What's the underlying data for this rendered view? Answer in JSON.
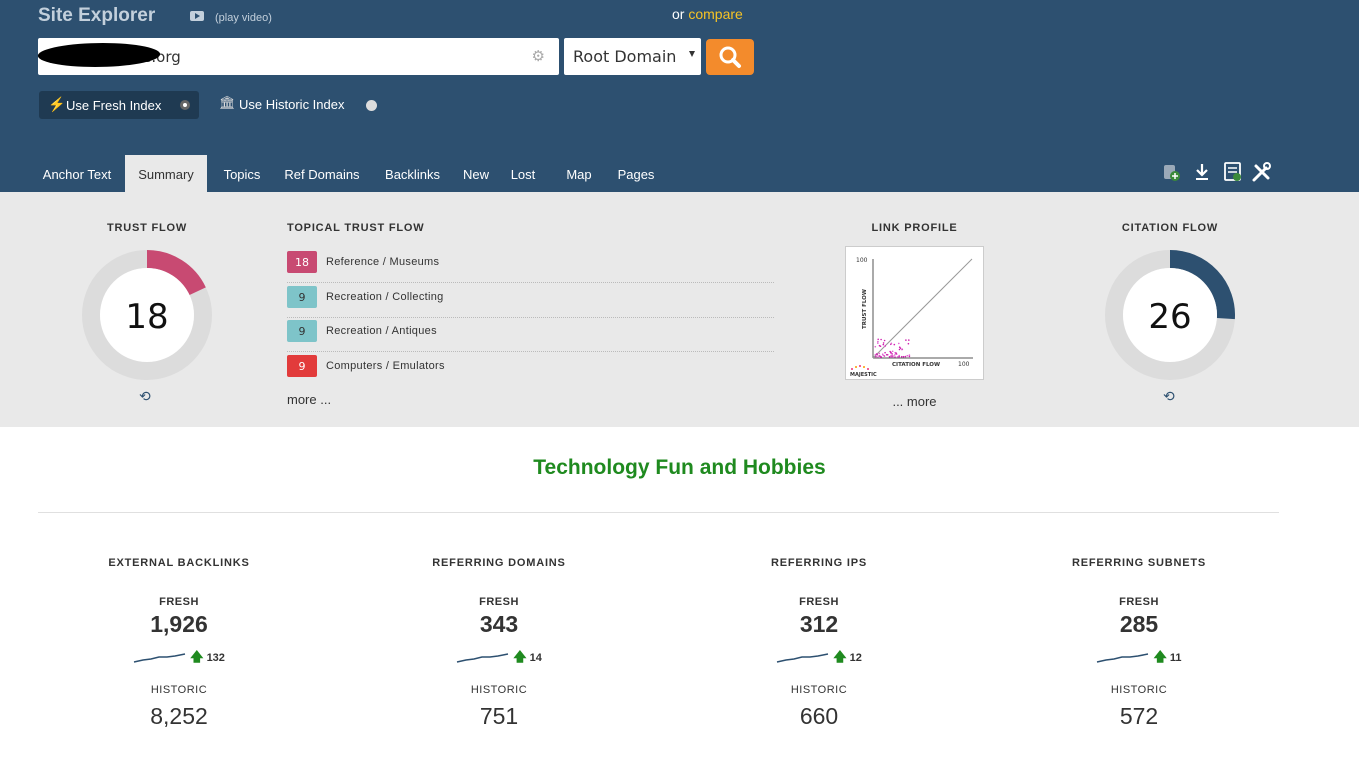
{
  "header": {
    "title": "Site Explorer",
    "play_video": "(play video)",
    "compare_prefix": "or",
    "compare_link": "compare",
    "search_value": "te                 e.org",
    "scope": "Root Domain",
    "fresh_index": "Use Fresh Index",
    "historic_index": "Use Historic Index"
  },
  "tabs": [
    "Anchor Text",
    "Summary",
    "Topics",
    "Ref Domains",
    "Backlinks",
    "New",
    "Lost",
    "Map",
    "Pages"
  ],
  "active_tab": "Summary",
  "trust_flow": {
    "label": "TRUST FLOW",
    "value": 18,
    "color": "#c84a72"
  },
  "citation_flow": {
    "label": "CITATION FLOW",
    "value": 26,
    "color": "#2d5070"
  },
  "topical_trust_flow": {
    "label": "TOPICAL TRUST FLOW",
    "items": [
      {
        "score": "18",
        "topic": "Reference / Museums",
        "color": "#c84a72"
      },
      {
        "score": "9",
        "topic": "Recreation / Collecting",
        "color": "#7ec4c9"
      },
      {
        "score": "9",
        "topic": "Recreation / Antiques",
        "color": "#7ec4c9"
      },
      {
        "score": "9",
        "topic": "Computers / Emulators",
        "color": "#e23b3b"
      }
    ],
    "more": "more ..."
  },
  "link_profile": {
    "label": "LINK PROFILE",
    "y_axis": "TRUST FLOW",
    "x_axis": "CITATION FLOW",
    "y_max": "100",
    "x_max": "100",
    "brand": "MAJESTIC",
    "more": "... more"
  },
  "category": "Technology Fun and Hobbies",
  "stats": [
    {
      "title": "EXTERNAL BACKLINKS",
      "fresh_label": "FRESH",
      "fresh": "1,926",
      "delta": "132",
      "historic_label": "HISTORIC",
      "historic": "8,252"
    },
    {
      "title": "REFERRING DOMAINS",
      "fresh_label": "FRESH",
      "fresh": "343",
      "delta": "14",
      "historic_label": "HISTORIC",
      "historic": "751"
    },
    {
      "title": "REFERRING IPS",
      "fresh_label": "FRESH",
      "fresh": "312",
      "delta": "12",
      "historic_label": "HISTORIC",
      "historic": "660"
    },
    {
      "title": "REFERRING SUBNETS",
      "fresh_label": "FRESH",
      "fresh": "285",
      "delta": "11",
      "historic_label": "HISTORIC",
      "historic": "572"
    }
  ]
}
